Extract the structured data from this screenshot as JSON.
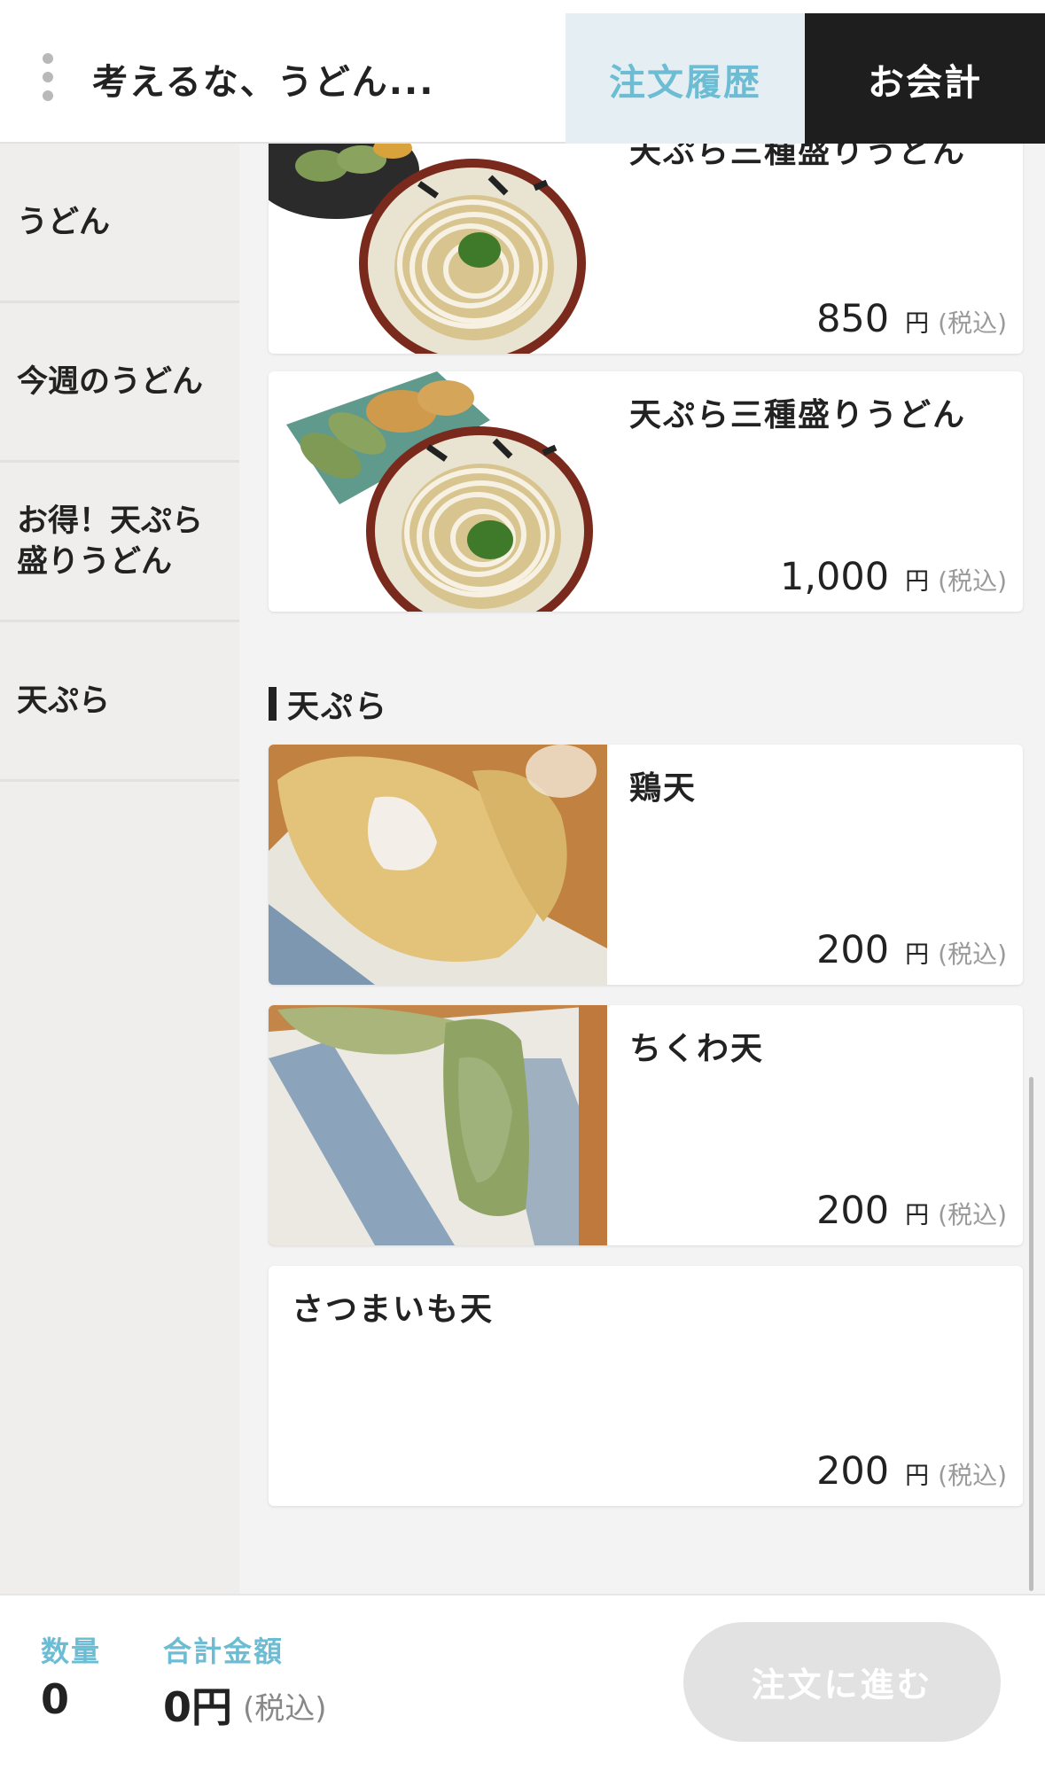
{
  "header": {
    "shop_name": "考えるな、うどん...",
    "order_history_label": "注文履歴",
    "checkout_label": "お会計"
  },
  "sidebar": {
    "items": [
      {
        "label": "うどん"
      },
      {
        "label": "今週のうどん"
      },
      {
        "label": "お得！天ぷら盛りうどん"
      },
      {
        "label": "天ぷら"
      }
    ]
  },
  "menu": {
    "items": [
      {
        "name": "天ぷら三種盛りうどん",
        "price": "850",
        "yen": "円",
        "tax": "(税込)",
        "image": "udon-tempura-plate"
      },
      {
        "name": "天ぷら三種盛りうどん",
        "price": "1,000",
        "yen": "円",
        "tax": "(税込)",
        "image": "udon-tempura-three"
      }
    ],
    "section": {
      "title": "天ぷら",
      "items": [
        {
          "name": "鶏天",
          "price": "200",
          "yen": "円",
          "tax": "(税込)",
          "image": "chicken-tempura"
        },
        {
          "name": "ちくわ天",
          "price": "200",
          "yen": "円",
          "tax": "(税込)",
          "image": "chikuwa-tempura"
        },
        {
          "name": "さつまいも天",
          "price": "200",
          "yen": "円",
          "tax": "(税込)"
        }
      ]
    }
  },
  "footer": {
    "quantity_label": "数量",
    "quantity_value": "0",
    "total_label": "合計金額",
    "total_value": "0円",
    "tax_label": "(税込)",
    "order_button_label": "注文に進む"
  },
  "colors": {
    "accent": "#6cbcd4",
    "dark": "#1e1e1e",
    "disabled": "#e2e2e2"
  }
}
